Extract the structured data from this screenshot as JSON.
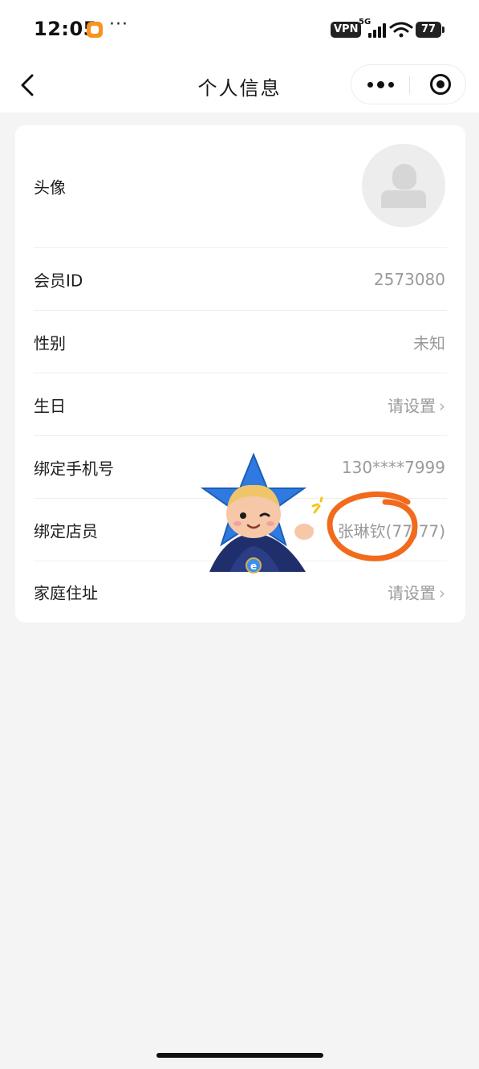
{
  "status_bar": {
    "time": "12:05",
    "more": "···",
    "vpn": "VPN",
    "network": "5G",
    "battery": "77"
  },
  "nav": {
    "title": "个人信息"
  },
  "profile": {
    "avatar_label": "头像",
    "member_id_label": "会员ID",
    "member_id_value": "2573080",
    "gender_label": "性别",
    "gender_value": "未知",
    "birthday_label": "生日",
    "birthday_value": "请设置",
    "phone_label": "绑定手机号",
    "phone_value": "130****7999",
    "clerk_label": "绑定店员",
    "clerk_value": "张琳钦(77)77)",
    "address_label": "家庭住址",
    "address_value": "请设置"
  },
  "icons": {
    "back": "chevron-left-icon",
    "menu": "more-dots-icon",
    "close": "target-circle-icon",
    "chevron": "chevron-right-icon",
    "avatar": "user-placeholder-icon"
  },
  "colors": {
    "background": "#f4f4f4",
    "card": "#ffffff",
    "value_text": "#9a9a9a",
    "annotation_ring": "#f26b1d",
    "mascot_star": "#2f7ae0"
  }
}
